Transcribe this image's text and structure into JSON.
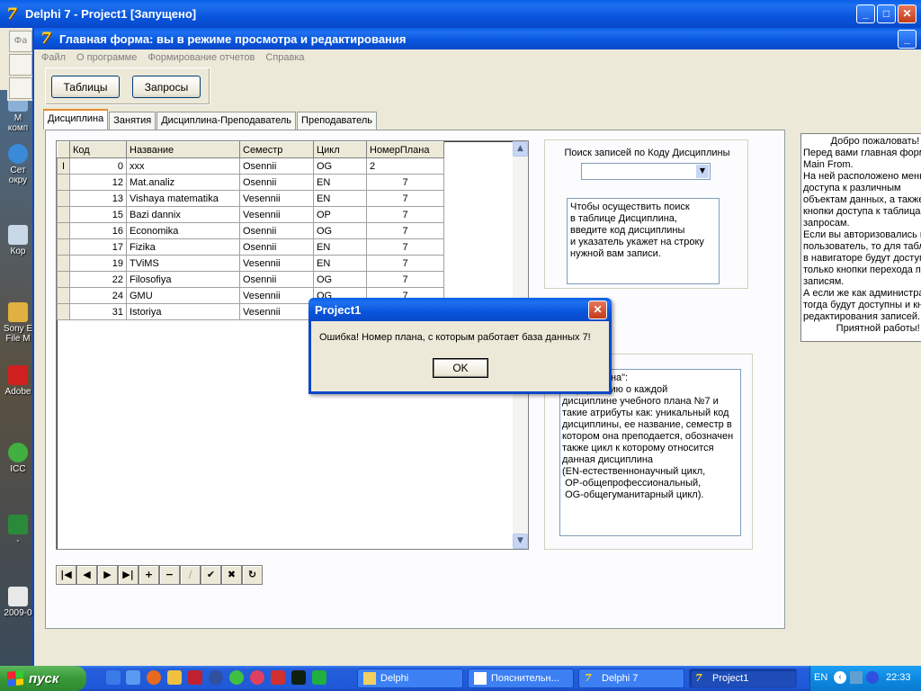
{
  "desktop": {
    "icons": [
      {
        "label": "М\nкомп"
      },
      {
        "label": "Сет\nокру"
      },
      {
        "label": "Кор"
      },
      {
        "label": "Sony E\nFile M"
      },
      {
        "label": "Adobe"
      },
      {
        "label": "ICC"
      },
      {
        "label": "-"
      },
      {
        "label": "2009-0"
      }
    ]
  },
  "delphi": {
    "title": "Delphi 7 - Project1 [Запущено]",
    "side_label": "Фа"
  },
  "mainform": {
    "title": "Главная форма: вы в режиме просмотра и редактирования",
    "menu": [
      "Файл",
      "О программе",
      "Формирование отчетов",
      "Справка"
    ],
    "buttons": {
      "tables": "Таблицы",
      "queries": "Запросы"
    },
    "tabs": [
      "Дисциплина",
      "Занятия",
      "Дисциплина-Преподаватель",
      "Преподаватель"
    ],
    "grid": {
      "headers": [
        "Код",
        "Название",
        "Семестр",
        "Цикл",
        "НомерПлана"
      ],
      "rows": [
        [
          "0",
          "xxx",
          "Osennii",
          "OG",
          "2"
        ],
        [
          "12",
          "Mat.analiz",
          "Osennii",
          "EN",
          "7"
        ],
        [
          "13",
          "Vishaya matematika",
          "Vesennii",
          "EN",
          "7"
        ],
        [
          "15",
          "Bazi dannix",
          "Vesennii",
          "OP",
          "7"
        ],
        [
          "16",
          "Economika",
          "Osennii",
          "OG",
          "7"
        ],
        [
          "17",
          "Fizika",
          "Osennii",
          "EN",
          "7"
        ],
        [
          "19",
          "TViMS",
          "Vesennii",
          "EN",
          "7"
        ],
        [
          "22",
          "Filosofiya",
          "Osennii",
          "OG",
          "7"
        ],
        [
          "24",
          "GMU",
          "Vesennii",
          "OG",
          "7"
        ],
        [
          "31",
          "Istoriya",
          "Vesennii",
          "",
          ""
        ]
      ]
    },
    "navigator": [
      "|◀",
      "◀",
      "▶",
      "▶|",
      "+",
      "−",
      "∕",
      "✔",
      "✖",
      "↻"
    ],
    "search": {
      "label": "Поиск записей по Коду Дисциплины",
      "combo_value": "",
      "hint": "Чтобы осуществить поиск\nв таблице Дисциплина,\nвведите код дисциплины\nи указатель укажет на строку\nнужной вам записи."
    },
    "info": {
      "text": "\"Дисциплина\":\nинформацию о каждой\nдисциплине учебного плана №7 и\nтакие атрибуты как: уникальный код\nдисциплины, ее название, семестр в\nкотором она преподается, обозначен\nтакже цикл к которому относится\nданная дисциплина\n(EN-естественнонаучный цикл,\n OP-общепрофессиональный,\n OG-общегуманитарный цикл)."
    },
    "welcome": "          Добро пожаловать!\nПеред вами главная форм\nMain From.\nНа ней расположено меню\nдоступа к различным\nобъектам данных, а также\nкнопки доступа к таблица\nзапросам.\nЕсли вы авторизовались к\nпользователь, то для табл\nв навигаторе будут доступ\nтолько кнопки перехода п\nзаписям.\nА если же как администра\nтогда будут доступны и кн\nредактирования записей.\n            Приятной работы!"
  },
  "dialog": {
    "title": "Project1",
    "message": "Ошибка! Номер плана, с которым работает база данных 7!",
    "ok": "OK"
  },
  "taskbar": {
    "start": "пуск",
    "tasks": [
      "Delphi",
      "Пояснительн...",
      "Delphi 7",
      "Project1"
    ],
    "lang": "EN",
    "clock": "22:33"
  }
}
